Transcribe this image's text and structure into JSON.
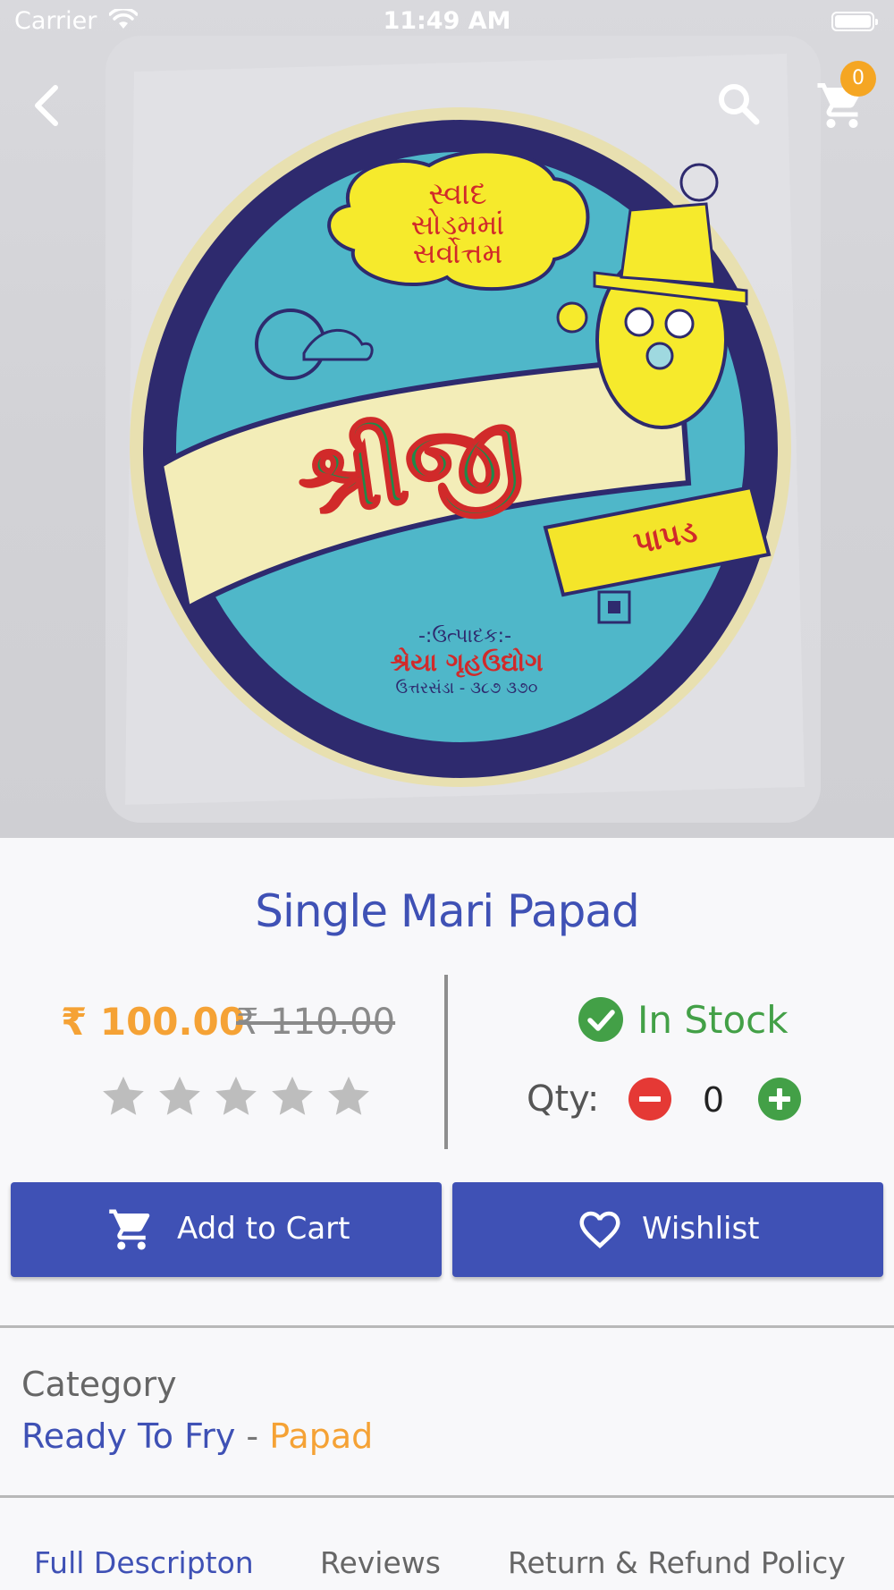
{
  "status_bar": {
    "carrier": "Carrier",
    "time": "11:49 AM"
  },
  "nav": {
    "back_icon": "chevron-left-icon",
    "search_icon": "search-icon",
    "cart_icon": "shopping-cart-icon",
    "cart_count": "0"
  },
  "hero_image": {
    "description_icon": "product-photo",
    "package_text": {
      "bubble_line_1": "સ્વાદ",
      "bubble_line_2": "સોડમમાં",
      "bubble_line_3": "સર્વોત્તમ",
      "brand": "શ્રીજી",
      "ribbon": "પાપડ",
      "maker_label": "-:ઉત્પાદક:-",
      "maker_name": "શ્રેયા ગૃહઉદ્યોગ",
      "maker_address": "ઉત્તરસંડા - ૩૮૭ ૩૭૦"
    }
  },
  "product": {
    "title": "Single Mari Papad",
    "price": "₹ 100.00",
    "original_price": "₹ 110.00",
    "rating": 0,
    "rating_max": 5,
    "stock_status": "In Stock",
    "qty_label": "Qty:",
    "qty_value": "0"
  },
  "actions": {
    "add_to_cart": "Add to Cart",
    "wishlist": "Wishlist"
  },
  "category": {
    "heading": "Category",
    "parent": "Ready To Fry",
    "separator": " - ",
    "child": "Papad"
  },
  "tabs": [
    {
      "label": "Full Descripton",
      "active": true
    },
    {
      "label": "Reviews",
      "active": false
    },
    {
      "label": "Return & Refund Policy",
      "active": false
    }
  ],
  "colors": {
    "primary": "#3f51b5",
    "accent": "#f5a235",
    "success": "#43a047",
    "danger": "#e53935",
    "star_empty": "#bdbdbd"
  }
}
